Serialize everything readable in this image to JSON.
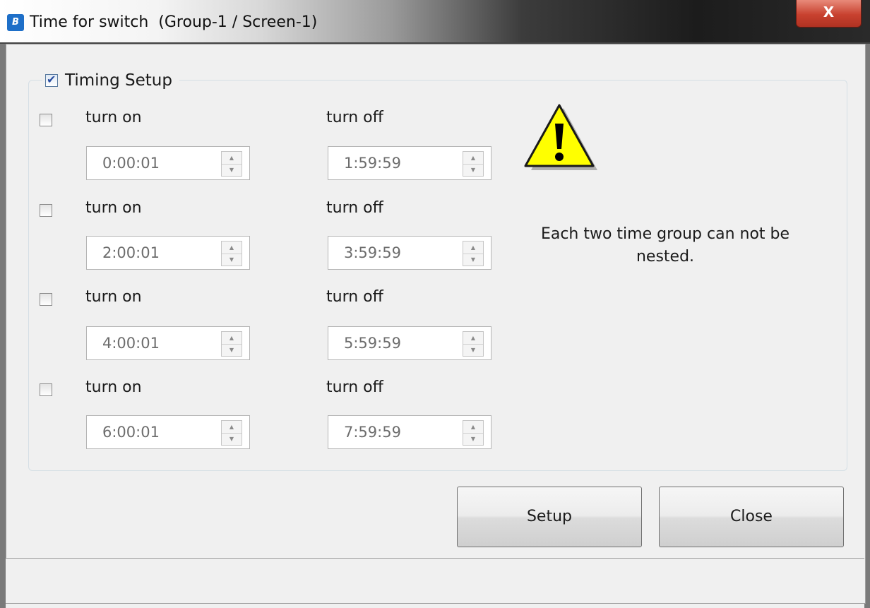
{
  "window": {
    "title": "Time for switch  (Group-1 / Screen-1)",
    "icon_text": "B",
    "close_glyph": "X"
  },
  "timing_setup": {
    "label": "Timing Setup",
    "checked": true
  },
  "rows": [
    {
      "checked": false,
      "on_label": "turn on",
      "off_label": "turn off",
      "on_value": "0:00:01",
      "off_value": "1:59:59"
    },
    {
      "checked": false,
      "on_label": "turn on",
      "off_label": "turn off",
      "on_value": "2:00:01",
      "off_value": "3:59:59"
    },
    {
      "checked": false,
      "on_label": "turn on",
      "off_label": "turn off",
      "on_value": "4:00:01",
      "off_value": "5:59:59"
    },
    {
      "checked": false,
      "on_label": "turn on",
      "off_label": "turn off",
      "on_value": "6:00:01",
      "off_value": "7:59:59"
    }
  ],
  "warning": {
    "icon": "warning-icon",
    "text_line1": "Each two time group can not be",
    "text_line2": "nested."
  },
  "buttons": {
    "setup": "Setup",
    "close": "Close"
  },
  "colors": {
    "warning_fill": "#ffff00",
    "close_red": "#c8412f",
    "checkmark": "#2a4ea0"
  }
}
